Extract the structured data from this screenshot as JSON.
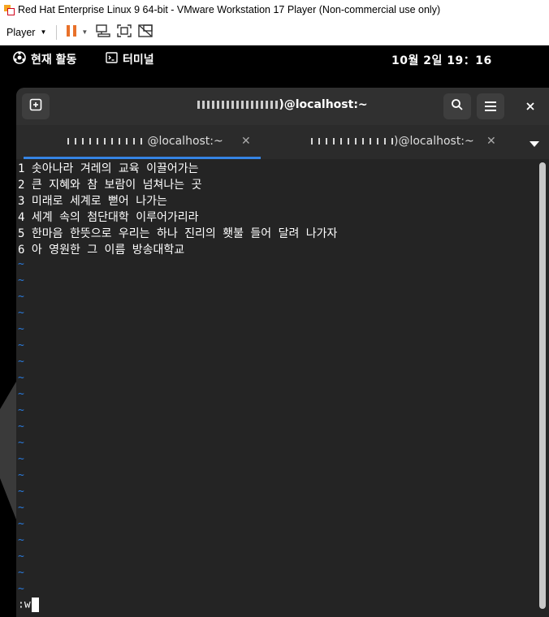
{
  "vmware": {
    "window_title": "Red Hat Enterprise Linux 9 64-bit - VMware Workstation 17 Player (Non-commercial use only)",
    "player_menu_label": "Player",
    "icons": [
      "vmware-app-icon",
      "pause-icon",
      "send-ctrl-alt-del-icon",
      "fit-guest-icon",
      "unity-icon"
    ],
    "accent_pause": "#e8712a"
  },
  "gnome": {
    "activities_label": "현재 활동",
    "app_label": "터미널",
    "clock": "10월 2일  19：16"
  },
  "terminal": {
    "title_suffix": ")@localhost:~",
    "tabs": [
      {
        "label_suffix": "@localhost:~",
        "active": true
      },
      {
        "label_suffix": ")@localhost:~",
        "active": false
      }
    ],
    "lines": [
      {
        "num": "1",
        "text": "솟아나라 겨레의 교육 이끌어가는"
      },
      {
        "num": "2",
        "text": "큰 지혜와 참 보람이 넘쳐나는 곳"
      },
      {
        "num": "3",
        "text": "미래로 세계로 뻗어 나가는"
      },
      {
        "num": "4",
        "text": "세계 속의 첨단대학 이루어가리라"
      },
      {
        "num": "5",
        "text": "한마음 한뜻으로 우리는 하나 진리의 횃불 들어 달려 나가자"
      },
      {
        "num": "6",
        "text": "아 영원한 그 이름 방송대학교"
      }
    ],
    "empty_marker": "~",
    "empty_line_count": 21,
    "command_line": ":w",
    "colors": {
      "background": "#242424",
      "tilde": "#2a7bde",
      "tab_underline": "#3584e4"
    }
  }
}
